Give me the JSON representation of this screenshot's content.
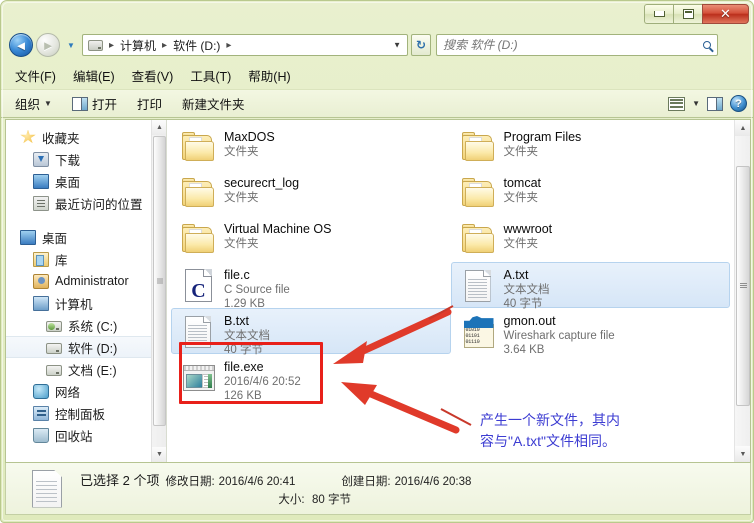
{
  "window": {
    "caption_buttons": {
      "minimize": "—",
      "maximize": "❐",
      "close": "✕"
    }
  },
  "address_bar": {
    "back_tooltip": "后退",
    "forward_tooltip": "前进",
    "crumbs": [
      "计算机",
      "软件 (D:)"
    ],
    "separator": "▸",
    "dropdown_caret": "▼",
    "refresh_label": "↻",
    "search_placeholder": "搜索 软件 (D:)"
  },
  "menubar": {
    "items": [
      {
        "label": "文件(F)"
      },
      {
        "label": "编辑(E)"
      },
      {
        "label": "查看(V)"
      },
      {
        "label": "工具(T)"
      },
      {
        "label": "帮助(H)"
      }
    ]
  },
  "toolbar": {
    "organize_label": "组织",
    "organize_caret": "▼",
    "open_label": "打开",
    "print_label": "打印",
    "new_folder_label": "新建文件夹",
    "views_caret": "▼"
  },
  "sidebar": {
    "items": [
      {
        "label": "收藏夹",
        "icon": "star-icon",
        "indent": 0,
        "selected": false
      },
      {
        "label": "下载",
        "icon": "downloads-icon",
        "indent": 1,
        "selected": false
      },
      {
        "label": "桌面",
        "icon": "desktop-icon",
        "indent": 1,
        "selected": false
      },
      {
        "label": "最近访问的位置",
        "icon": "recent-places-icon",
        "indent": 1,
        "selected": false
      },
      {
        "label": "桌面",
        "icon": "desktop-icon",
        "indent": 0,
        "selected": false
      },
      {
        "label": "库",
        "icon": "library-icon",
        "indent": 1,
        "selected": false
      },
      {
        "label": "Administrator",
        "icon": "user-folder-icon",
        "indent": 1,
        "selected": false
      },
      {
        "label": "计算机",
        "icon": "computer-icon",
        "indent": 1,
        "selected": false
      },
      {
        "label": "系统 (C:)",
        "icon": "system-drive-icon",
        "indent": 2,
        "selected": false
      },
      {
        "label": "软件 (D:)",
        "icon": "drive-icon",
        "indent": 2,
        "selected": true
      },
      {
        "label": "文档 (E:)",
        "icon": "drive-icon",
        "indent": 2,
        "selected": false
      },
      {
        "label": "网络",
        "icon": "network-icon",
        "indent": 1,
        "selected": false
      },
      {
        "label": "控制面板",
        "icon": "control-panel-icon",
        "indent": 1,
        "selected": false
      },
      {
        "label": "回收站",
        "icon": "recycle-bin-icon",
        "indent": 1,
        "selected": false
      }
    ]
  },
  "files": [
    {
      "name": "MaxDOS",
      "type": "文件夹",
      "size": "",
      "icon": "folder-icon",
      "selected": false
    },
    {
      "name": "Program Files",
      "type": "文件夹",
      "size": "",
      "icon": "folder-icon",
      "selected": false
    },
    {
      "name": "securecrt_log",
      "type": "文件夹",
      "size": "",
      "icon": "folder-icon",
      "selected": false
    },
    {
      "name": "tomcat",
      "type": "文件夹",
      "size": "",
      "icon": "folder-icon",
      "selected": false
    },
    {
      "name": "Virtual Machine OS",
      "type": "文件夹",
      "size": "",
      "icon": "folder-icon",
      "selected": false
    },
    {
      "name": "wwwroot",
      "type": "文件夹",
      "size": "",
      "icon": "folder-icon",
      "selected": false
    },
    {
      "name": "file.c",
      "type": "C Source file",
      "size": "1.29 KB",
      "icon": "c-source-icon",
      "selected": false
    },
    {
      "name": "A.txt",
      "type": "文本文档",
      "size": "40 字节",
      "icon": "text-document-icon",
      "selected": true
    },
    {
      "name": "B.txt",
      "type": "文本文档",
      "size": "40 字节",
      "icon": "text-document-icon",
      "selected": true
    },
    {
      "name": "gmon.out",
      "type": "Wireshark capture file",
      "size": "3.64 KB",
      "icon": "wireshark-capture-icon",
      "selected": false
    },
    {
      "name": "file.exe",
      "type": "2016/4/6 20:52",
      "size": "126 KB",
      "icon": "application-icon",
      "selected": false
    }
  ],
  "annotation": {
    "line1": "产生一个新文件，其内",
    "line2": "容与\"A.txt\"文件相同。",
    "highlight_color": "#e8201a",
    "text_color": "#3c3cd2"
  },
  "status_bar": {
    "selection": "已选择 2 个项",
    "modified_label": "修改日期:",
    "modified_value": "2016/4/6 20:41",
    "created_label": "创建日期:",
    "created_value": "2016/4/6 20:38",
    "size_label": "大小:",
    "size_value": "80 字节"
  },
  "scrollbars": {
    "up_arrow": "▲",
    "down_arrow": "▼"
  }
}
